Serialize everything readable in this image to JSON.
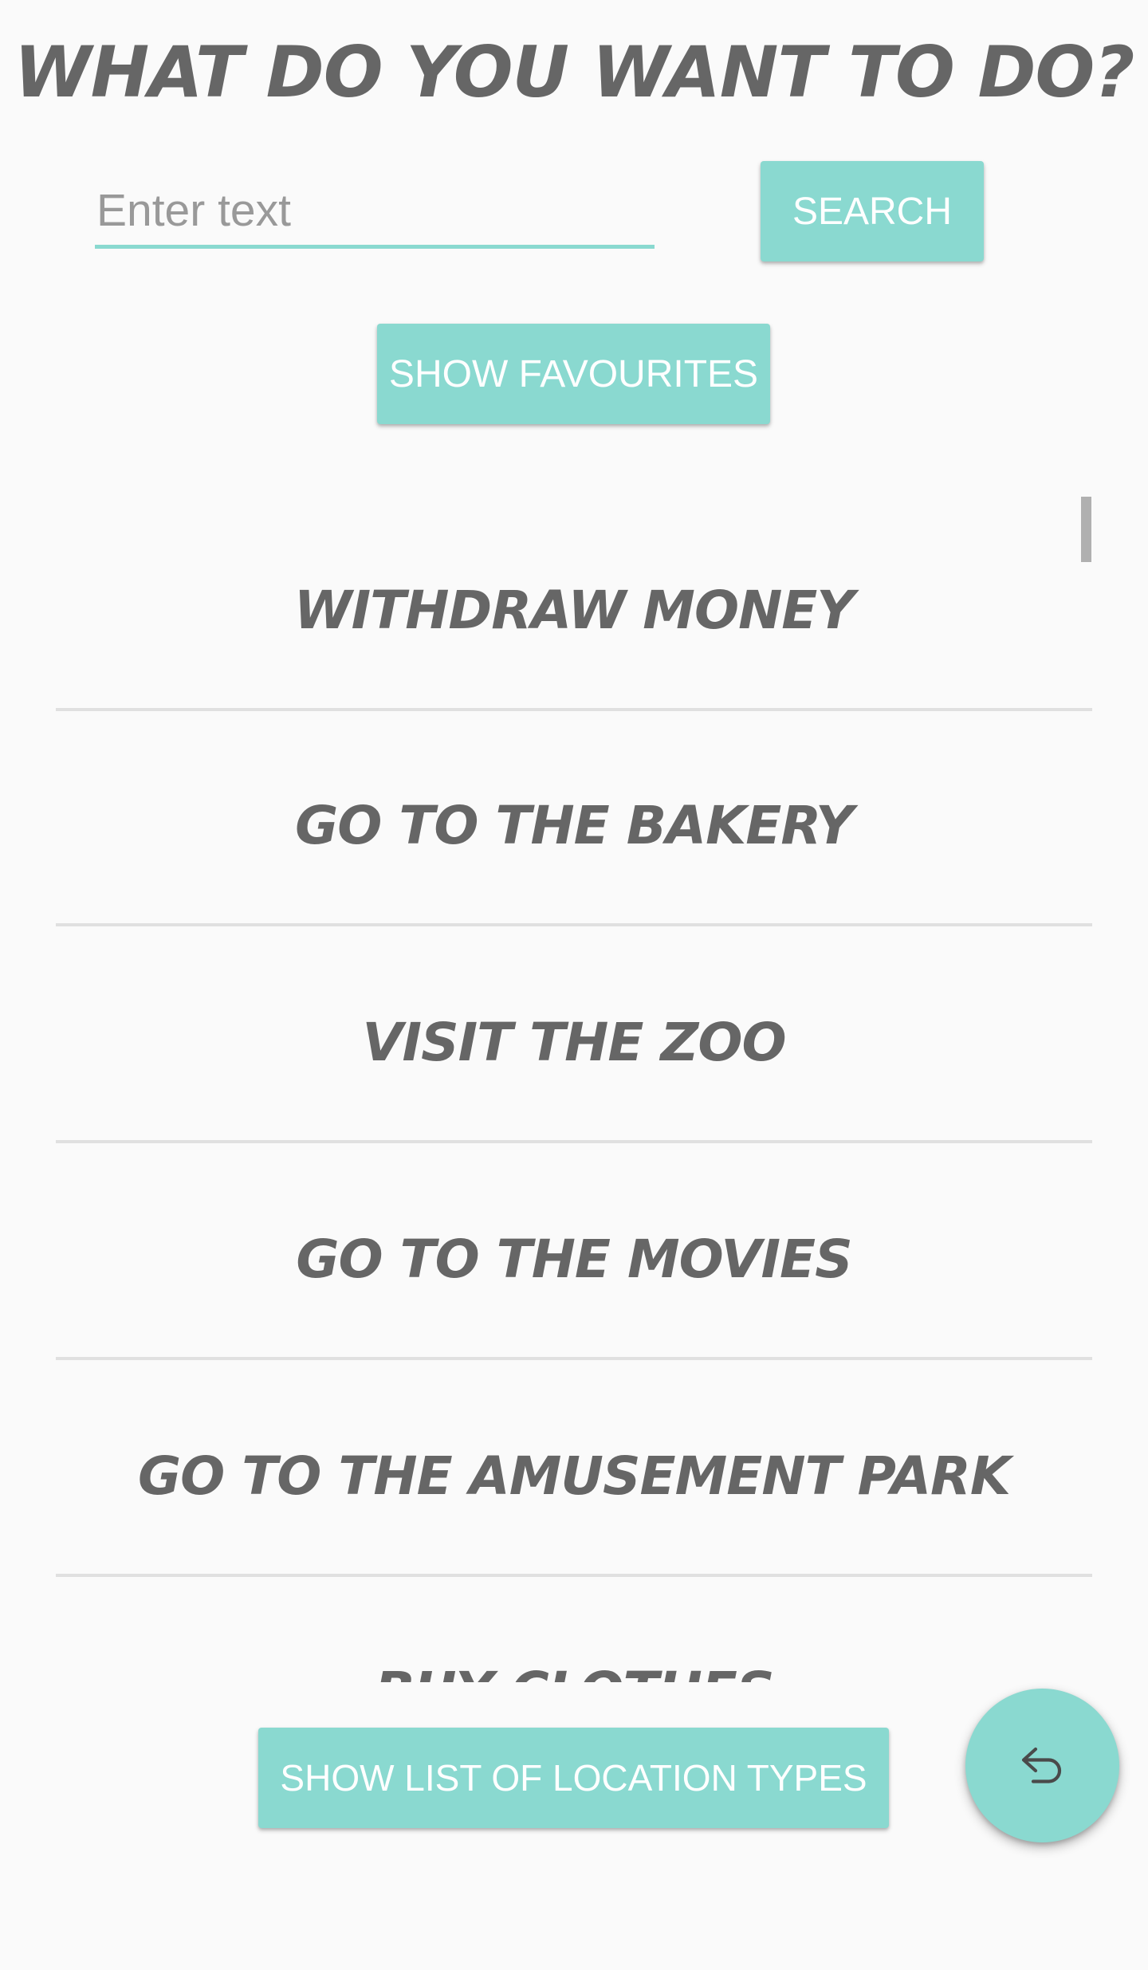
{
  "header": {
    "title": "WHAT DO YOU WANT TO DO?"
  },
  "search": {
    "placeholder": "Enter text",
    "value": "",
    "button_label": "SEARCH"
  },
  "favourites": {
    "button_label": "SHOW FAVOURITES"
  },
  "activities": {
    "items": [
      {
        "label": "WITHDRAW MONEY"
      },
      {
        "label": "GO TO THE BAKERY"
      },
      {
        "label": "VISIT THE ZOO"
      },
      {
        "label": "GO TO THE MOVIES"
      },
      {
        "label": "GO TO THE AMUSEMENT PARK"
      },
      {
        "label": "BUY CLOTHES"
      }
    ]
  },
  "footer": {
    "location_types_button_label": "SHOW LIST OF LOCATION TYPES",
    "fab_icon": "undo-icon"
  },
  "colors": {
    "accent": "#8ad9d0",
    "text": "#666666",
    "background": "#fafafa",
    "divider": "#e0e0e0"
  }
}
